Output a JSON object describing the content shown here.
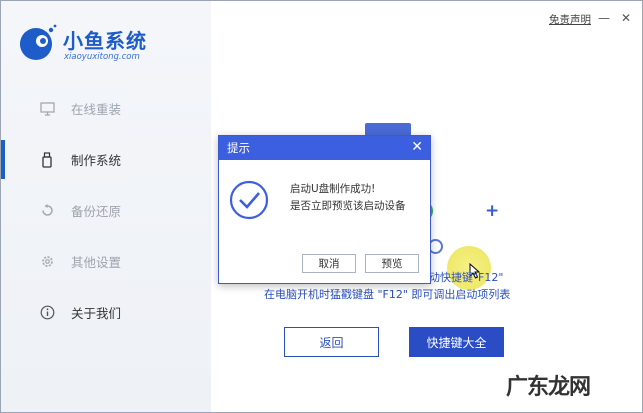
{
  "app": {
    "brand_name": "小鱼系统",
    "brand_domain": "xiaoyuxitong.com",
    "disclaimer": "免责声明",
    "minimize_glyph": "—",
    "close_glyph": "✕"
  },
  "sidebar": {
    "items": [
      {
        "label": "在线重装",
        "icon": "monitor-icon"
      },
      {
        "label": "制作系统",
        "icon": "usb-icon",
        "active": true
      },
      {
        "label": "备份还原",
        "icon": "backup-icon"
      },
      {
        "label": "其他设置",
        "icon": "gear-icon"
      },
      {
        "label": "关于我们",
        "icon": "info-icon"
      }
    ]
  },
  "main": {
    "hint_line1": "动快捷键\"F12\"",
    "hint_line2": "在电脑开机时猛戳键盘 \"F12\" 即可调出启动项列表",
    "back_button": "返回",
    "shortcut_button": "快捷键大全"
  },
  "dialog": {
    "title": "提示",
    "message_line1": "启动U盘制作成功!",
    "message_line2": "是否立即预览该启动设备",
    "cancel": "取消",
    "preview": "预览"
  },
  "watermark": "广东龙网",
  "colors": {
    "accent": "#1d5cc9",
    "dialog_header": "#3c5fe0",
    "button_primary": "#2a4dc6"
  }
}
